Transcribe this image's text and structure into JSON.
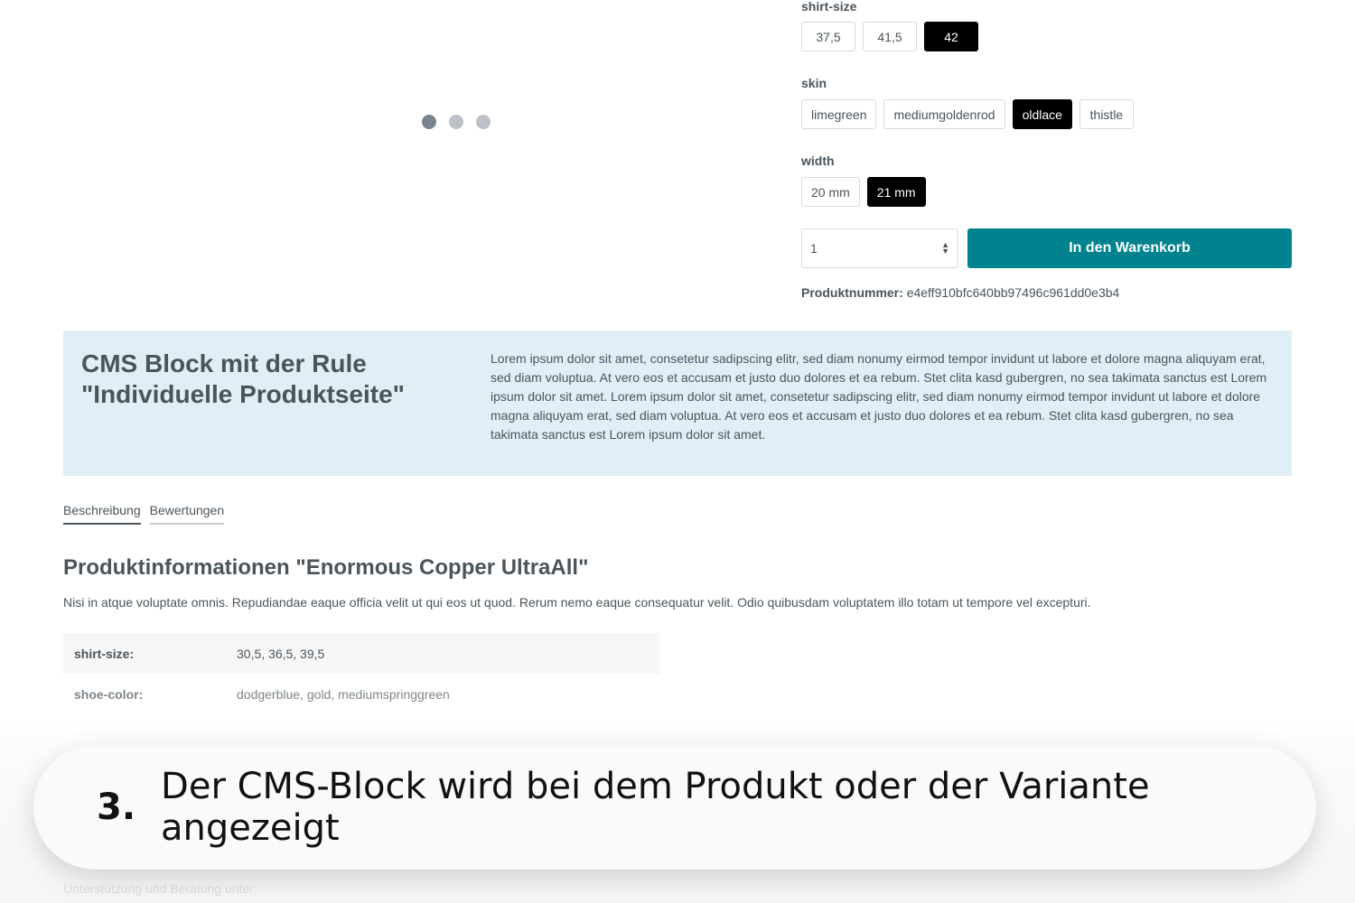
{
  "gallery": {
    "dots": 3,
    "active": 0
  },
  "variants": [
    {
      "label": "shirt-size",
      "options": [
        "37,5",
        "41,5",
        "42"
      ],
      "selected": 2
    },
    {
      "label": "skin",
      "options": [
        "limegreen",
        "mediumgoldenrod",
        "oldlace",
        "thistle"
      ],
      "selected": 2
    },
    {
      "label": "width",
      "options": [
        "20 mm",
        "21 mm"
      ],
      "selected": 1
    }
  ],
  "buy": {
    "quantity": "1",
    "cart_label": "In den Warenkorb",
    "product_number_label": "Produktnummer:",
    "product_number": "e4eff910bfc640bb97496c961dd0e3b4"
  },
  "cms": {
    "title": "CMS Block mit der Rule \"Individuelle Produktseite\"",
    "text": "Lorem ipsum dolor sit amet, consetetur sadipscing elitr, sed diam nonumy eirmod tempor invidunt ut labore et dolore magna aliquyam erat, sed diam voluptua. At vero eos et accusam et justo duo dolores et ea rebum. Stet clita kasd gubergren, no sea takimata sanctus est Lorem ipsum dolor sit amet. Lorem ipsum dolor sit amet, consetetur sadipscing elitr, sed diam nonumy eirmod tempor invidunt ut labore et dolore magna aliquyam erat, sed diam voluptua. At vero eos et accusam et justo duo dolores et ea rebum. Stet clita kasd gubergren, no sea takimata sanctus est Lorem ipsum dolor sit amet."
  },
  "tabs": [
    "Beschreibung",
    "Bewertungen"
  ],
  "product": {
    "title": "Produktinformationen \"Enormous Copper UltraAll\"",
    "description": "Nisi in atque voluptate omnis. Repudiandae eaque officia velit ut qui eos ut quod. Rerum nemo eaque consequatur velit. Odio quibusdam voluptatem illo totam ut tempore vel excepturi.",
    "properties": [
      {
        "key": "shirt-size:",
        "value": "30,5, 36,5, 39,5"
      },
      {
        "key": "shoe-color:",
        "value": "dodgerblue, gold, mediumspringgreen"
      }
    ]
  },
  "footer": {
    "support": "Unterstützung und Beratung unter:"
  },
  "caption": {
    "number": "3.",
    "text": "Der CMS-Block wird bei dem Produkt oder der Variante angezeigt"
  },
  "colors": {
    "accent": "#00838f",
    "cms_bg": "#e0eff6"
  }
}
